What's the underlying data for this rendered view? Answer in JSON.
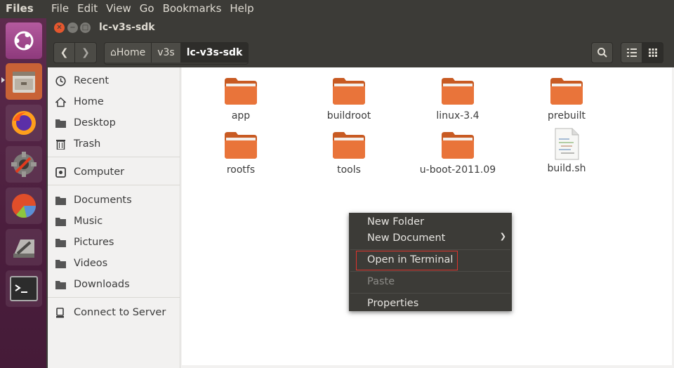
{
  "topbar": {
    "app_name": "Files",
    "menu": [
      "File",
      "Edit",
      "View",
      "Go",
      "Bookmarks",
      "Help"
    ]
  },
  "launcher": {
    "items": [
      "ubuntu-dash-icon",
      "files-icon",
      "firefox-icon",
      "system-settings-icon",
      "disk-usage-icon",
      "utilities-icon",
      "terminal-icon"
    ]
  },
  "window": {
    "title": "lc-v3s-sdk",
    "breadcrumb": [
      "Home",
      "v3s",
      "lc-v3s-sdk"
    ]
  },
  "sidebar": {
    "places": [
      "Recent",
      "Home",
      "Desktop",
      "Trash"
    ],
    "devices": [
      "Computer"
    ],
    "bookmarks": [
      "Documents",
      "Music",
      "Pictures",
      "Videos",
      "Downloads"
    ],
    "network": [
      "Connect to Server"
    ]
  },
  "files": [
    {
      "name": "app",
      "type": "folder"
    },
    {
      "name": "buildroot",
      "type": "folder"
    },
    {
      "name": "linux-3.4",
      "type": "folder"
    },
    {
      "name": "prebuilt",
      "type": "folder"
    },
    {
      "name": "rootfs",
      "type": "folder"
    },
    {
      "name": "tools",
      "type": "folder"
    },
    {
      "name": "u-boot-2011.09",
      "type": "folder"
    },
    {
      "name": "build.sh",
      "type": "file"
    }
  ],
  "context_menu": {
    "new_folder": "New Folder",
    "new_document": "New Document",
    "open_terminal": "Open in Terminal",
    "paste": "Paste",
    "properties": "Properties"
  },
  "colors": {
    "folder": "#e9743a",
    "highlight": "#e0332c",
    "accent": "#dd4814"
  }
}
